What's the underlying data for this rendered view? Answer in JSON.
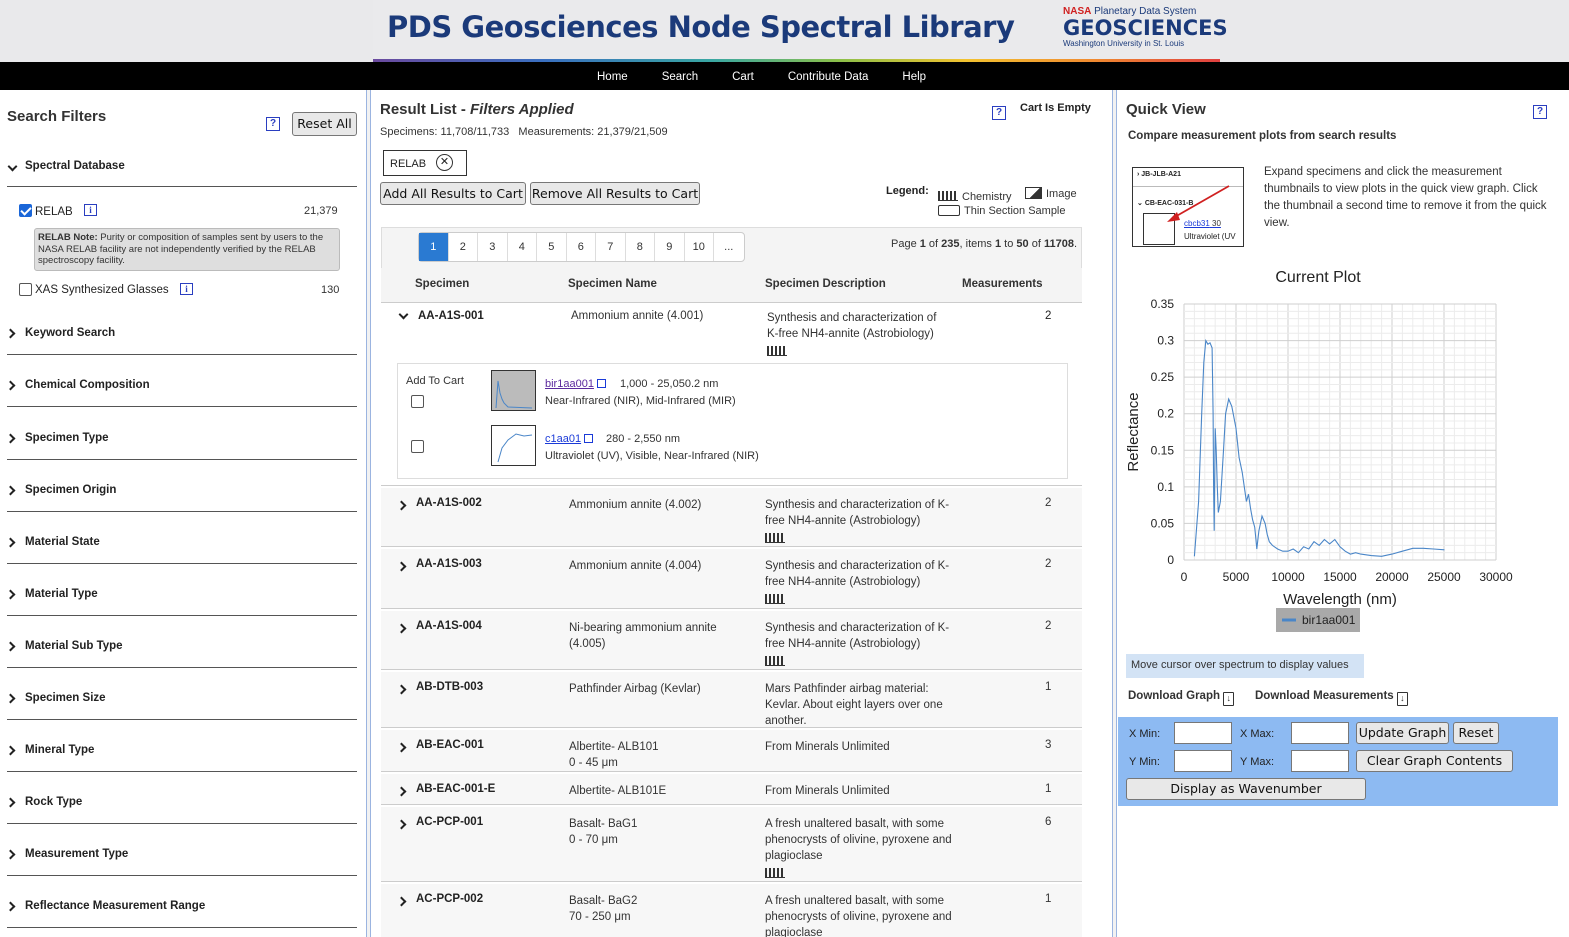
{
  "header": {
    "title": "PDS Geosciences Node Spectral Library",
    "logo_line1_nasa": "NASA",
    "logo_line1_rest": "Planetary Data System",
    "logo_line2": "GEOSCIENCES",
    "logo_line3": "Washington University in St. Louis"
  },
  "nav": [
    "Home",
    "Search",
    "Cart",
    "Contribute Data",
    "Help"
  ],
  "filters": {
    "title": "Search Filters",
    "help": "?",
    "reset_label": "Reset All",
    "spectral_db_label": "Spectral Database",
    "relab_label": "RELAB",
    "relab_count": "21,379",
    "relab_note_bold": "RELAB Note:",
    "relab_note_text": " Purity or composition of samples sent by users to the NASA RELAB facility are not independently verified by the RELAB spectroscopy facility.",
    "xas_label": "XAS Synthesized Glasses",
    "xas_count": "130",
    "info": "i",
    "sections": [
      "Keyword Search",
      "Chemical Composition",
      "Specimen Type",
      "Specimen Origin",
      "Material State",
      "Material Type",
      "Material Sub Type",
      "Specimen Size",
      "Mineral Type",
      "Rock Type",
      "Measurement Type",
      "Reflectance Measurement Range"
    ]
  },
  "results": {
    "title_prefix": "Result List - ",
    "title_italic": "Filters Applied",
    "help": "?",
    "cart_status": "Cart Is Empty",
    "counts": "Specimens: 11,708/11,733   Measurements: 21,379/21,509",
    "chip_label": "RELAB",
    "chip_close": "✕",
    "add_all": "Add All Results to Cart",
    "remove_all": "Remove All Results to Cart",
    "legend_title": "Legend:",
    "legend_chem": "Chemistry",
    "legend_image": "Image",
    "legend_thin": "Thin Section Sample",
    "pages": [
      "1",
      "2",
      "3",
      "4",
      "5",
      "6",
      "7",
      "8",
      "9",
      "10",
      "..."
    ],
    "page_info": {
      "page_word": "Page ",
      "page": "1",
      "of_word": " of ",
      "total_pages": "235",
      "items_word": ", items ",
      "from": "1",
      "to_word": " to ",
      "to": "50",
      "of2_word": " of ",
      "total": "11708",
      "dot": "."
    },
    "columns": [
      "Specimen",
      "Specimen Name",
      "Specimen Description",
      "Measurements"
    ],
    "expanded": {
      "id": "AA-A1S-001",
      "name": "Ammonium annite (4.001)",
      "desc": "Synthesis and characterization of K-free NH4-annite (Astrobiology)",
      "meas": "2",
      "add_to_cart": "Add To Cart",
      "m1_id": "bir1aa001",
      "m1_range": "1,000 - 25,050.2 nm",
      "m1_type": "Near-Infrared (NIR), Mid-Infrared (MIR)",
      "m2_id": "c1aa01",
      "m2_range": "280 - 2,550 nm",
      "m2_type": "Ultraviolet (UV), Visible, Near-Infrared (NIR)"
    },
    "rows": [
      {
        "id": "AA-A1S-002",
        "name": "Ammonium annite (4.002)",
        "desc": "Synthesis and characterization of K-free NH4-annite (Astrobiology)",
        "meas": "2"
      },
      {
        "id": "AA-A1S-003",
        "name": "Ammonium annite (4.004)",
        "desc": "Synthesis and characterization of K-free NH4-annite (Astrobiology)",
        "meas": "2"
      },
      {
        "id": "AA-A1S-004",
        "name": "Ni-bearing ammonium annite (4.005)",
        "desc": "Synthesis and characterization of K-free NH4-annite (Astrobiology)",
        "meas": "2"
      },
      {
        "id": "AB-DTB-003",
        "name": "Pathfinder Airbag (Kevlar)",
        "desc": "Mars Pathfinder airbag material: Kevlar. About eight layers over one another.",
        "meas": "1"
      },
      {
        "id": "AB-EAC-001",
        "name": "Albertite- ALB101",
        "name2": "0 - 45 μm",
        "desc": "From Minerals Unlimited",
        "meas": "3"
      },
      {
        "id": "AB-EAC-001-E",
        "name": "Albertite- ALB101E",
        "desc": "From Minerals Unlimited",
        "meas": "1"
      },
      {
        "id": "AC-PCP-001",
        "name": "Basalt- BaG1",
        "name2": "0 - 70 μm",
        "desc": "A fresh unaltered basalt, with some phenocrysts of olivine, pyroxene and plagioclase",
        "meas": "6"
      },
      {
        "id": "AC-PCP-002",
        "name": "Basalt- BaG2",
        "name2": "70 - 250 μm",
        "desc": "A fresh unaltered basalt, with some phenocrysts of olivine, pyroxene and plagioclase",
        "meas": "1"
      }
    ]
  },
  "quickview": {
    "title": "Quick View",
    "help": "?",
    "subtitle": "Compare measurement plots from search results",
    "help_text": "Expand specimens and click the measurement thumbnails to view plots in the quick view graph. Click the thumbnail a second time to remove it from the quick view.",
    "img_row1": "JB-JLB-A21",
    "img_row2": "CB-EAC-031-B",
    "img_link": "cbcb31",
    "img_num": "30",
    "img_type": "Ultraviolet (UV",
    "hint": "Move cursor over spectrum to display values",
    "download_graph": "Download Graph",
    "download_meas": "Download Measurements",
    "xmin_label": "X Min:",
    "xmax_label": "X Max:",
    "ymin_label": "Y Min:",
    "ymax_label": "Y Max:",
    "update_label": "Update Graph",
    "reset_label": "Reset",
    "clear_label": "Clear Graph Contents",
    "wavenumber_label": "Display as Wavenumber"
  },
  "chart_data": {
    "type": "line",
    "title": "Current Plot",
    "xlabel": "Wavelength (nm)",
    "ylabel": "Reflectance",
    "xlim": [
      0,
      30000
    ],
    "ylim": [
      0,
      0.35
    ],
    "xticks": [
      "0",
      "5000",
      "10000",
      "15000",
      "20000",
      "25000",
      "30000"
    ],
    "yticks": [
      "0",
      "0.05",
      "0.1",
      "0.15",
      "0.2",
      "0.25",
      "0.3",
      "0.35"
    ],
    "grid": true,
    "legend": "bottom-center",
    "series": [
      {
        "name": "bir1aa001",
        "color": "#4a86c8",
        "x": [
          1000,
          1400,
          1700,
          1900,
          2100,
          2300,
          2500,
          2700,
          2800,
          2850,
          2900,
          3000,
          3100,
          3200,
          3300,
          3500,
          3800,
          4000,
          4300,
          4600,
          5000,
          5300,
          5600,
          5800,
          6000,
          6200,
          6400,
          6600,
          6800,
          6900,
          7000,
          7200,
          7500,
          7800,
          8000,
          8200,
          8500,
          9000,
          9500,
          10000,
          10500,
          11000,
          11500,
          12000,
          12500,
          13000,
          13500,
          14000,
          14500,
          15000,
          15500,
          16000,
          16500,
          17000,
          18000,
          19000,
          20000,
          21000,
          22000,
          23000,
          24000,
          25050
        ],
        "y": [
          0.005,
          0.08,
          0.2,
          0.27,
          0.3,
          0.295,
          0.297,
          0.29,
          0.2,
          0.1,
          0.04,
          0.18,
          0.15,
          0.1,
          0.065,
          0.08,
          0.15,
          0.2,
          0.22,
          0.21,
          0.18,
          0.14,
          0.12,
          0.1,
          0.08,
          0.09,
          0.07,
          0.055,
          0.045,
          0.03,
          0.015,
          0.04,
          0.06,
          0.05,
          0.035,
          0.025,
          0.02,
          0.015,
          0.012,
          0.012,
          0.015,
          0.01,
          0.018,
          0.015,
          0.025,
          0.02,
          0.028,
          0.022,
          0.028,
          0.018,
          0.012,
          0.008,
          0.01,
          0.008,
          0.006,
          0.005,
          0.008,
          0.012,
          0.016,
          0.016,
          0.015,
          0.014
        ]
      }
    ]
  }
}
